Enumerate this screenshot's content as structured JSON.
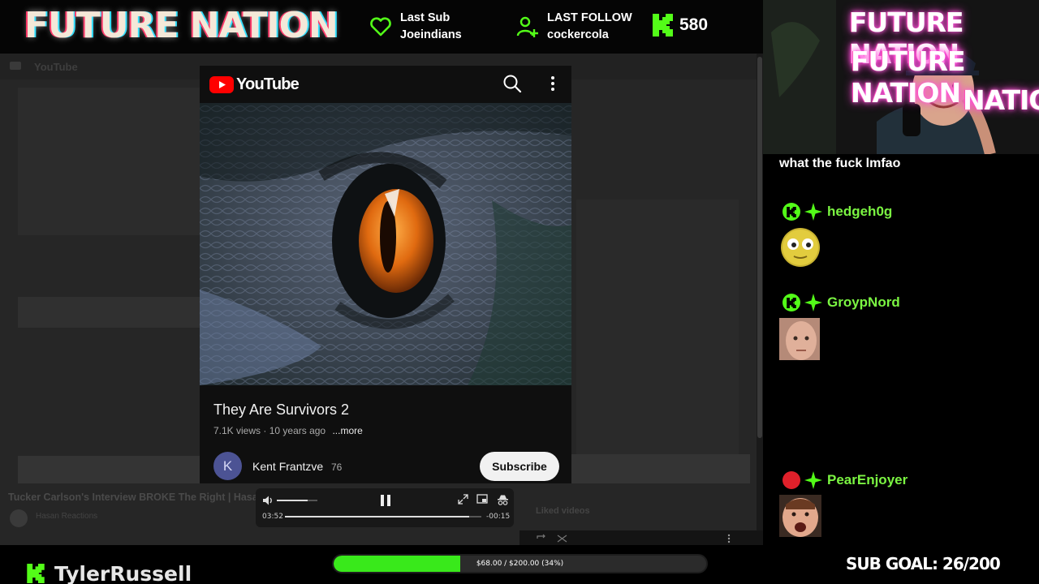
{
  "colors": {
    "kick_green": "#53fc18",
    "chat_name_green": "#7bf542",
    "goal_fill": "#39e91b",
    "youtube_red": "#ff0000"
  },
  "overlay": {
    "brand": "FUTURE NATION",
    "last_sub": {
      "icon": "heart-icon",
      "label": "Last Sub",
      "value": "Joeindians"
    },
    "last_follow": {
      "icon": "add-user-icon",
      "label": "LAST FOLLOW",
      "value": "cockercola"
    },
    "kick_count": {
      "icon": "kick-logo-icon",
      "value": "580"
    },
    "neon_lines": [
      "FUTURE NATION",
      "FUTURE NATION",
      "NATION"
    ]
  },
  "background": {
    "site": "YouTube",
    "video_title": "Tucker Carlson's Interview BROKE The Right | Hasa",
    "channel": "Hasan Reactions",
    "liked_panel": "Liked videos"
  },
  "youtube": {
    "logo_text": "YouTube",
    "title": "They Are Survivors 2",
    "views": "7.1K views",
    "age": "10 years ago",
    "more": "...more",
    "channel_initial": "K",
    "channel_name": "Kent Frantzve",
    "subs": "76",
    "subscribe_label": "Subscribe"
  },
  "player": {
    "current_time": "03:52",
    "remaining_time": "-00:15",
    "progress": 0.94,
    "volume": 0.75
  },
  "chat": {
    "message": "what the fuck lmfao",
    "entries": [
      {
        "badge": "kick-badge-icon",
        "name": "hedgeh0g",
        "emote": "eyes-emote"
      },
      {
        "badge": "kick-badge-icon",
        "name": "GroypNord",
        "emote": "face-emote"
      },
      {
        "badge": "red-badge-icon",
        "name": "PearEnjoyer",
        "emote": "shouting-face-emote"
      }
    ]
  },
  "footer": {
    "handle": "TylerRussell",
    "goal_text": "$68.00 / $200.00 (34%)",
    "goal_progress": 0.34,
    "sub_goal": "SUB GOAL: 26/200"
  }
}
